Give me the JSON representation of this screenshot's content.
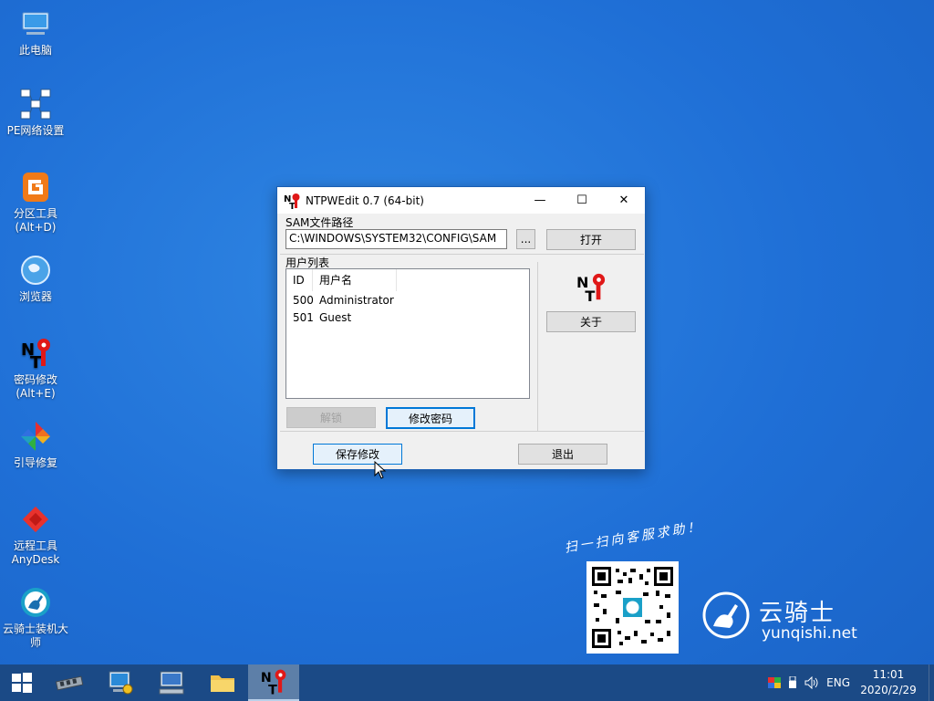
{
  "desktop": {
    "icons": [
      {
        "label": "此电脑",
        "icon": "computer-icon"
      },
      {
        "label": "PE网络设置",
        "icon": "network-icon"
      },
      {
        "label": "分区工具\n(Alt+D)",
        "icon": "diskgenius-icon"
      },
      {
        "label": "浏览器",
        "icon": "globe-icon"
      },
      {
        "label": "密码修改\n(Alt+E)",
        "icon": "ntpwedit-icon"
      },
      {
        "label": "引导修复",
        "icon": "pinwheel-icon"
      },
      {
        "label": "远程工具\nAnyDesk",
        "icon": "anydesk-icon"
      },
      {
        "label": "云骑士装机大\n师",
        "icon": "yunqishi-icon"
      }
    ],
    "watermark": {
      "slogan": "扫一扫向客服求助！",
      "brand_cn": "云骑士",
      "brand_en": "yunqishi.net"
    }
  },
  "window": {
    "title": "NTPWEdit 0.7 (64-bit)",
    "controls": {
      "minimize": "—",
      "maximize": "☐",
      "close": "✕"
    },
    "sam_label": "SAM文件路径",
    "sam_path": "C:\\WINDOWS\\SYSTEM32\\CONFIG\\SAM",
    "browse_label": "...",
    "open_label": "打开",
    "users_label": "用户列表",
    "columns": [
      "ID",
      "用户名"
    ],
    "users": [
      {
        "id": "500",
        "name": "Administrator"
      },
      {
        "id": "501",
        "name": "Guest"
      }
    ],
    "unlock_label": "解锁",
    "change_password_label": "修改密码",
    "about_label": "关于",
    "save_label": "保存修改",
    "exit_label": "退出"
  },
  "taskbar": {
    "apps": [
      "memory-icon",
      "network-monitor-icon",
      "computer-manage-icon",
      "folder-icon",
      "ntpwedit-icon"
    ],
    "active_app": "ntpwedit-icon",
    "language": "ENG",
    "time": "11:01",
    "date": "2020/2/29"
  },
  "colors": {
    "desktop_bg": "#1f6fd6",
    "taskbar_bg": "#1b4a86",
    "accent": "#0078d7"
  }
}
